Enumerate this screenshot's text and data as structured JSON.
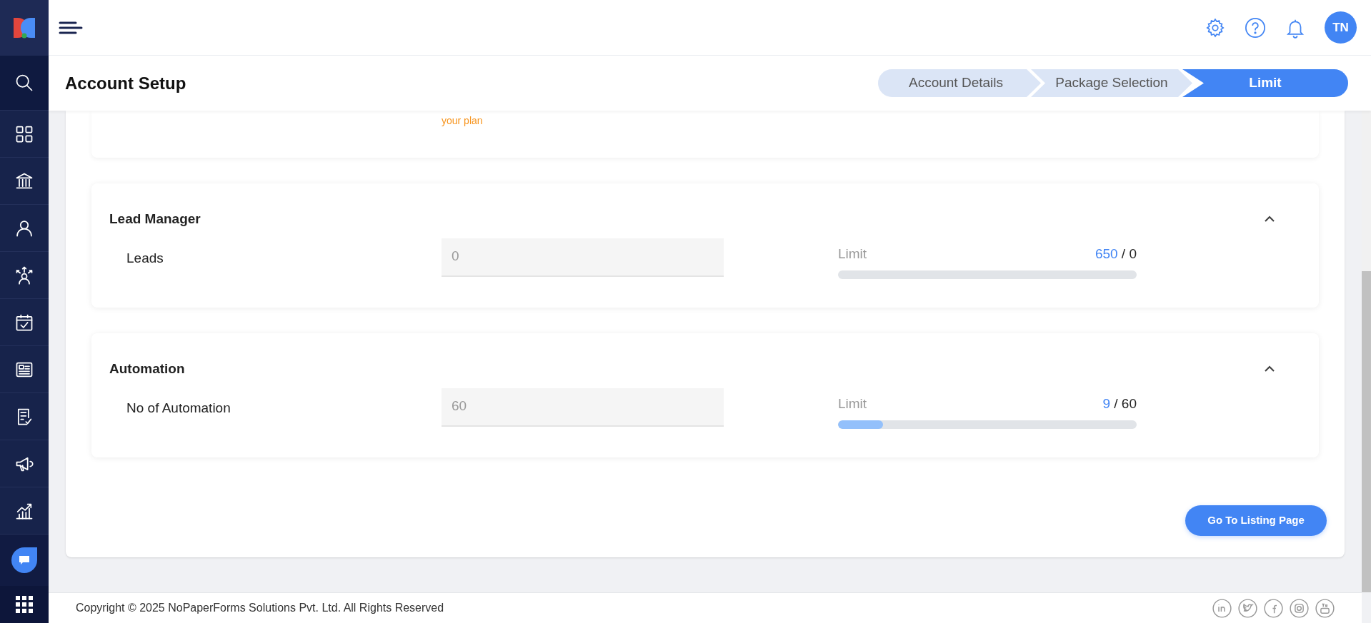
{
  "header": {
    "avatar": "TN"
  },
  "page": {
    "title": "Account Setup"
  },
  "steps": [
    {
      "label": "Account Details",
      "selected": false
    },
    {
      "label": "Package Selection",
      "selected": false
    },
    {
      "label": "Limit",
      "selected": true
    }
  ],
  "plan_note": "your plan",
  "sections": [
    {
      "title": "Lead Manager",
      "expanded": true,
      "label": "Leads",
      "value": "0",
      "limit_label": "Limit",
      "used": "650",
      "separator": "/",
      "total": "0",
      "level": 0
    },
    {
      "title": "Automation",
      "expanded": true,
      "label": "No of Automation",
      "value": "60",
      "limit_label": "Limit",
      "used": "9",
      "separator": "/",
      "total": "60",
      "level": 0.15
    }
  ],
  "action_button": "Go To Listing Page",
  "footer": {
    "copyright": "Copyright © 2025 NoPaperForms Solutions Pvt. Ltd. All Rights Reserved"
  }
}
